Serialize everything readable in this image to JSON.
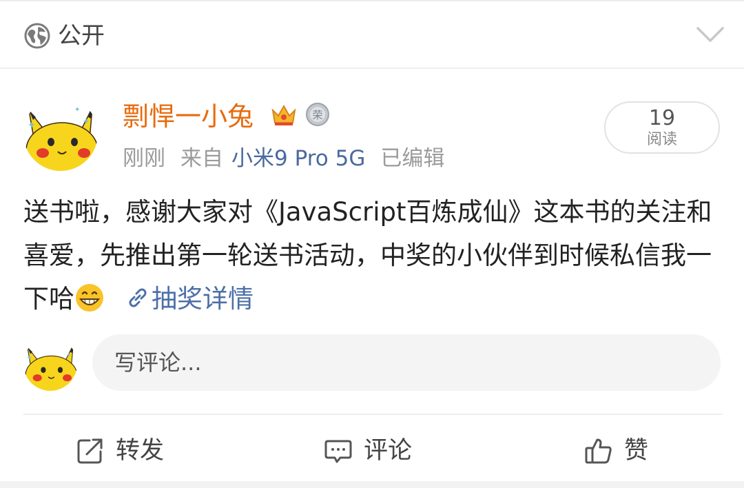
{
  "header": {
    "visibility_icon": "globe-icon",
    "visibility_label": "公开",
    "expand_icon": "chevron-down-icon"
  },
  "post": {
    "author": {
      "name": "剽悍一小兔",
      "avatar": "pikachu-avatar",
      "badges": [
        "crown-icon",
        "silver-medal-icon"
      ],
      "name_color": "#e86b0c"
    },
    "meta": {
      "time": "刚刚",
      "source_prefix": "来自",
      "source": "小米9 Pro 5G",
      "edited": "已编辑"
    },
    "reads": {
      "count": "19",
      "label": "阅读"
    },
    "text": " 送书啦，感谢大家对《JavaScript百炼成仙》这本书的关注和喜爱，先推出第一轮送书活动，中奖的小伙伴到时候私信我一下哈",
    "emoji": "grinning-face-icon",
    "link": {
      "icon": "link-icon",
      "label": "抽奖详情",
      "color": "#4c6fa8"
    }
  },
  "comment": {
    "placeholder": "写评论..."
  },
  "actions": {
    "repost": "转发",
    "comment": "评论",
    "like": "赞"
  }
}
